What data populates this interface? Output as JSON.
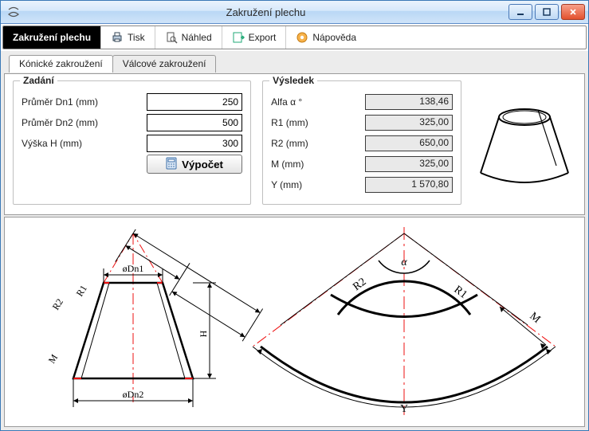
{
  "window": {
    "title": "Zakružení plechu"
  },
  "toolbar": {
    "main": "Zakružení plechu",
    "print": "Tisk",
    "preview": "Náhled",
    "export": "Export",
    "help": "Nápověda"
  },
  "tabs": {
    "conical": "Kónické zakroužení",
    "cylindrical": "Válcové zakroužení"
  },
  "input_group": {
    "legend": "Zadání",
    "dn1": {
      "label": "Průměr Dn1 (mm)",
      "value": "250"
    },
    "dn2": {
      "label": "Průměr Dn2 (mm)",
      "value": "500"
    },
    "h": {
      "label": "Výška H (mm)",
      "value": "300"
    },
    "compute": "Výpočet"
  },
  "output_group": {
    "legend": "Výsledek",
    "alfa": {
      "label": "Alfa α °",
      "value": "138,46"
    },
    "r1": {
      "label": "R1 (mm)",
      "value": "325,00"
    },
    "r2": {
      "label": "R2 (mm)",
      "value": "650,00"
    },
    "m": {
      "label": "M (mm)",
      "value": "325,00"
    },
    "y": {
      "label": "Y (mm)",
      "value": "1 570,80"
    }
  },
  "diagram_labels": {
    "dn1": "øDn1",
    "dn2": "øDn2",
    "r1": "R1",
    "r2": "R2",
    "m": "M",
    "h": "H",
    "alpha": "α",
    "y": "Y"
  }
}
